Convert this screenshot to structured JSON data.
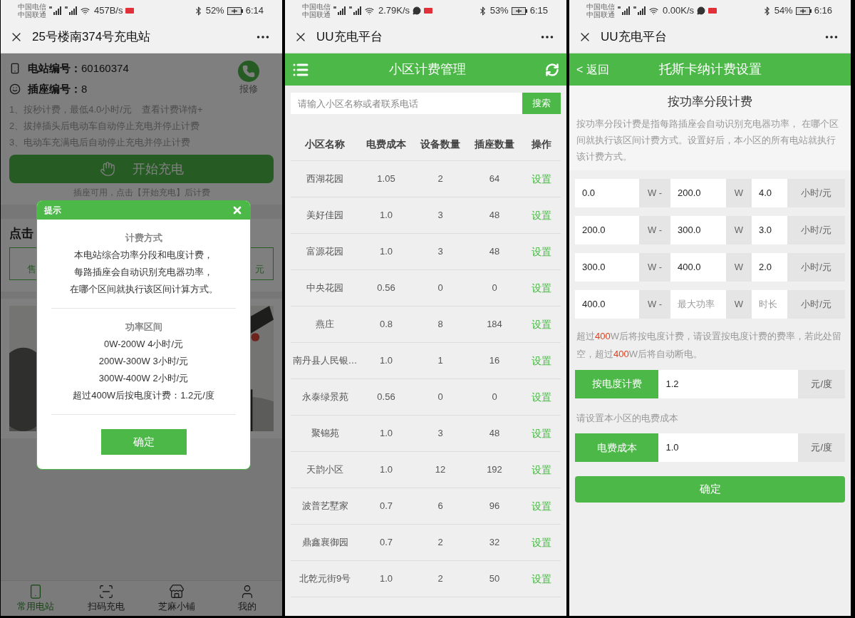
{
  "station_screen": {
    "status_bar": {
      "carriers": [
        "中国电信",
        "中国联通"
      ],
      "speed": "457B/s",
      "chat_notification": false,
      "battery": "52%",
      "time": "6:14"
    },
    "title": "25号楼南374号充电站",
    "station_number": {
      "label": "电站编号：",
      "value": "60160374"
    },
    "socket_number": {
      "label": "插座编号：",
      "value": "8"
    },
    "repair_label": "报修",
    "rules": [
      "1、按秒计费，最低4.0小时/元",
      "2、拔掉插头后电动车自动停止充电并停止计费",
      "3、电动车充满电后自动停止充电并停止计费"
    ],
    "details_link": "查看计费详情+",
    "start_button": "开始充电",
    "hint": "插座可用，点击【开始充电】后计费",
    "section_title": "点击",
    "boxes": [
      "售",
      "元"
    ],
    "dialog": {
      "title": "提示",
      "sections": [
        {
          "heading": "计费方式",
          "lines": [
            "本电站综合功率分段和电度计费，",
            "每路插座会自动识别充电器功率，",
            "在哪个区间就执行该区间计算方式。"
          ]
        },
        {
          "heading": "功率区间",
          "lines": [
            "0W-200W 4小时/元",
            "200W-300W 3小时/元",
            "300W-400W 2小时/元",
            "超过400W后按电度计费：1.2元/度"
          ]
        }
      ],
      "confirm": "确定"
    },
    "tabs": [
      {
        "label": "常用电站",
        "kind": "station",
        "selected": true
      },
      {
        "label": "扫码充电",
        "kind": "scan",
        "selected": false
      },
      {
        "label": "芝麻小铺",
        "kind": "shop",
        "selected": false
      },
      {
        "label": "我的",
        "kind": "user",
        "selected": false
      }
    ]
  },
  "billing_list_screen": {
    "status_bar": {
      "carriers": [
        "中国电信",
        "中国联通"
      ],
      "speed": "2.79K/s",
      "chat_notification": true,
      "battery": "53%",
      "time": "6:15"
    },
    "title": "UU充电平台",
    "header": "小区计费管理",
    "search": {
      "placeholder": "请输入小区名称或者联系电话",
      "button": "搜索"
    },
    "columns": [
      "小区名称",
      "电费成本",
      "设备数量",
      "插座数量",
      "操作"
    ],
    "rows": [
      {
        "name": "西湖花园",
        "cost": "1.05",
        "devices": "2",
        "sockets": "64",
        "action": "设置"
      },
      {
        "name": "美好佳园",
        "cost": "1.0",
        "devices": "3",
        "sockets": "48",
        "action": "设置"
      },
      {
        "name": "富源花园",
        "cost": "1.0",
        "devices": "3",
        "sockets": "48",
        "action": "设置"
      },
      {
        "name": "中央花园",
        "cost": "0.56",
        "devices": "0",
        "sockets": "0",
        "action": "设置"
      },
      {
        "name": "燕庄",
        "cost": "0.8",
        "devices": "8",
        "sockets": "184",
        "action": "设置"
      },
      {
        "name": "南丹县人民银…",
        "cost": "1.0",
        "devices": "1",
        "sockets": "16",
        "action": "设置"
      },
      {
        "name": "永泰绿景苑",
        "cost": "0.56",
        "devices": "0",
        "sockets": "0",
        "action": "设置"
      },
      {
        "name": "聚锦苑",
        "cost": "1.0",
        "devices": "3",
        "sockets": "48",
        "action": "设置"
      },
      {
        "name": "天韵小区",
        "cost": "1.0",
        "devices": "12",
        "sockets": "192",
        "action": "设置"
      },
      {
        "name": "波普艺墅家",
        "cost": "0.7",
        "devices": "6",
        "sockets": "96",
        "action": "设置"
      },
      {
        "name": "鼎鑫襄御园",
        "cost": "0.7",
        "devices": "2",
        "sockets": "32",
        "action": "设置"
      },
      {
        "name": "北乾元街9号",
        "cost": "1.0",
        "devices": "2",
        "sockets": "50",
        "action": "设置"
      }
    ]
  },
  "billing_settings_screen": {
    "status_bar": {
      "carriers": [
        "中国电信",
        "中国联通"
      ],
      "speed": "0.00K/s",
      "chat_notification": true,
      "battery": "54%",
      "time": "6:16"
    },
    "title": "UU充电平台",
    "back": "< 返回",
    "header": "托斯卡纳计费设置",
    "section_title": "按功率分段计费",
    "description": "按功率分段计费是指每路插座会自动识别充电器功率， 在哪个区间就执行该区间计费方式。设置好后，本小区的所有电站就执行该计费方式。",
    "tiers": [
      {
        "from": "0.0",
        "from_unit": "W -",
        "to": {
          "value": "200.0"
        },
        "to_unit": "W",
        "hours": {
          "value": "4.0"
        },
        "rate_unit": "小时/元"
      },
      {
        "from": "200.0",
        "from_unit": "W -",
        "to": {
          "value": "300.0"
        },
        "to_unit": "W",
        "hours": {
          "value": "3.0"
        },
        "rate_unit": "小时/元"
      },
      {
        "from": "300.0",
        "from_unit": "W -",
        "to": {
          "value": "400.0"
        },
        "to_unit": "W",
        "hours": {
          "value": "2.0"
        },
        "rate_unit": "小时/元"
      },
      {
        "from": "400.0",
        "from_unit": "W -",
        "to": {
          "placeholder": "最大功率"
        },
        "to_unit": "W",
        "hours": {
          "placeholder": "时长"
        },
        "rate_unit": "小时/元"
      }
    ],
    "warning": [
      {
        "text": "超过",
        "highlight": false
      },
      {
        "text": "400",
        "highlight": true
      },
      {
        "text": "W后将按电度计费，请设置按电度计费的费率，若此处留空，超过",
        "highlight": false
      },
      {
        "text": "400",
        "highlight": true
      },
      {
        "text": "W后将自动断电。",
        "highlight": false
      }
    ],
    "energy_rate": {
      "label": "按电度计费",
      "value": "1.2",
      "unit": "元/度"
    },
    "cost_hint": "请设置本小区的电费成本",
    "cost": {
      "label": "电费成本",
      "value": "1.0",
      "unit": "元/度"
    },
    "confirm": "确定"
  }
}
